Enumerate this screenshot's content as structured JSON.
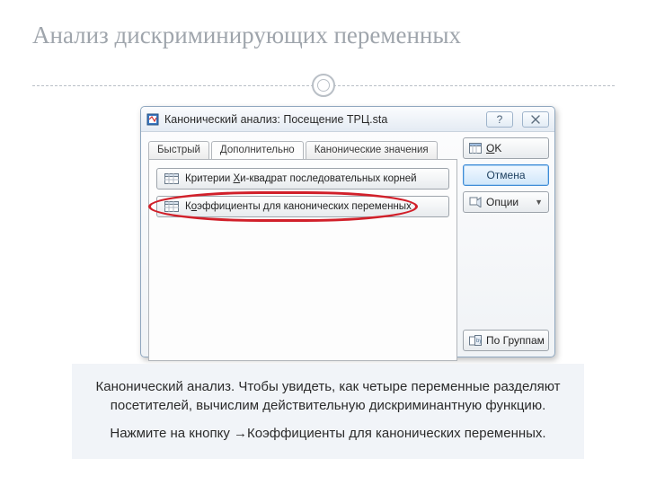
{
  "slide": {
    "title": "Анализ дискриминирующих переменных"
  },
  "dialog": {
    "title": "Канонический анализ: Посещение ТРЦ.sta",
    "tabs": {
      "quick": "Быстрый",
      "advanced": "Дополнительно",
      "canonical": "Канонические значения"
    },
    "panel": {
      "btn1_pre": "Критерии ",
      "btn1_hot": "Х",
      "btn1_post": "и-квадрат последовательных корней",
      "btn2_pre": "К",
      "btn2_hot": "о",
      "btn2_post": "эффициенты для канонических переменных"
    },
    "side": {
      "ok_hot": "O",
      "ok_post": "K",
      "cancel": "Отмена",
      "options": "Опции",
      "by_group": "По Группам"
    }
  },
  "caption": {
    "p1": "Канонический анализ. Чтобы увидеть, как четыре переменные разделяют посетителей, вычислим действительную дискриминантную функцию.",
    "p2": "Нажмите на кнопку →Коэффициенты для канонических переменных."
  }
}
